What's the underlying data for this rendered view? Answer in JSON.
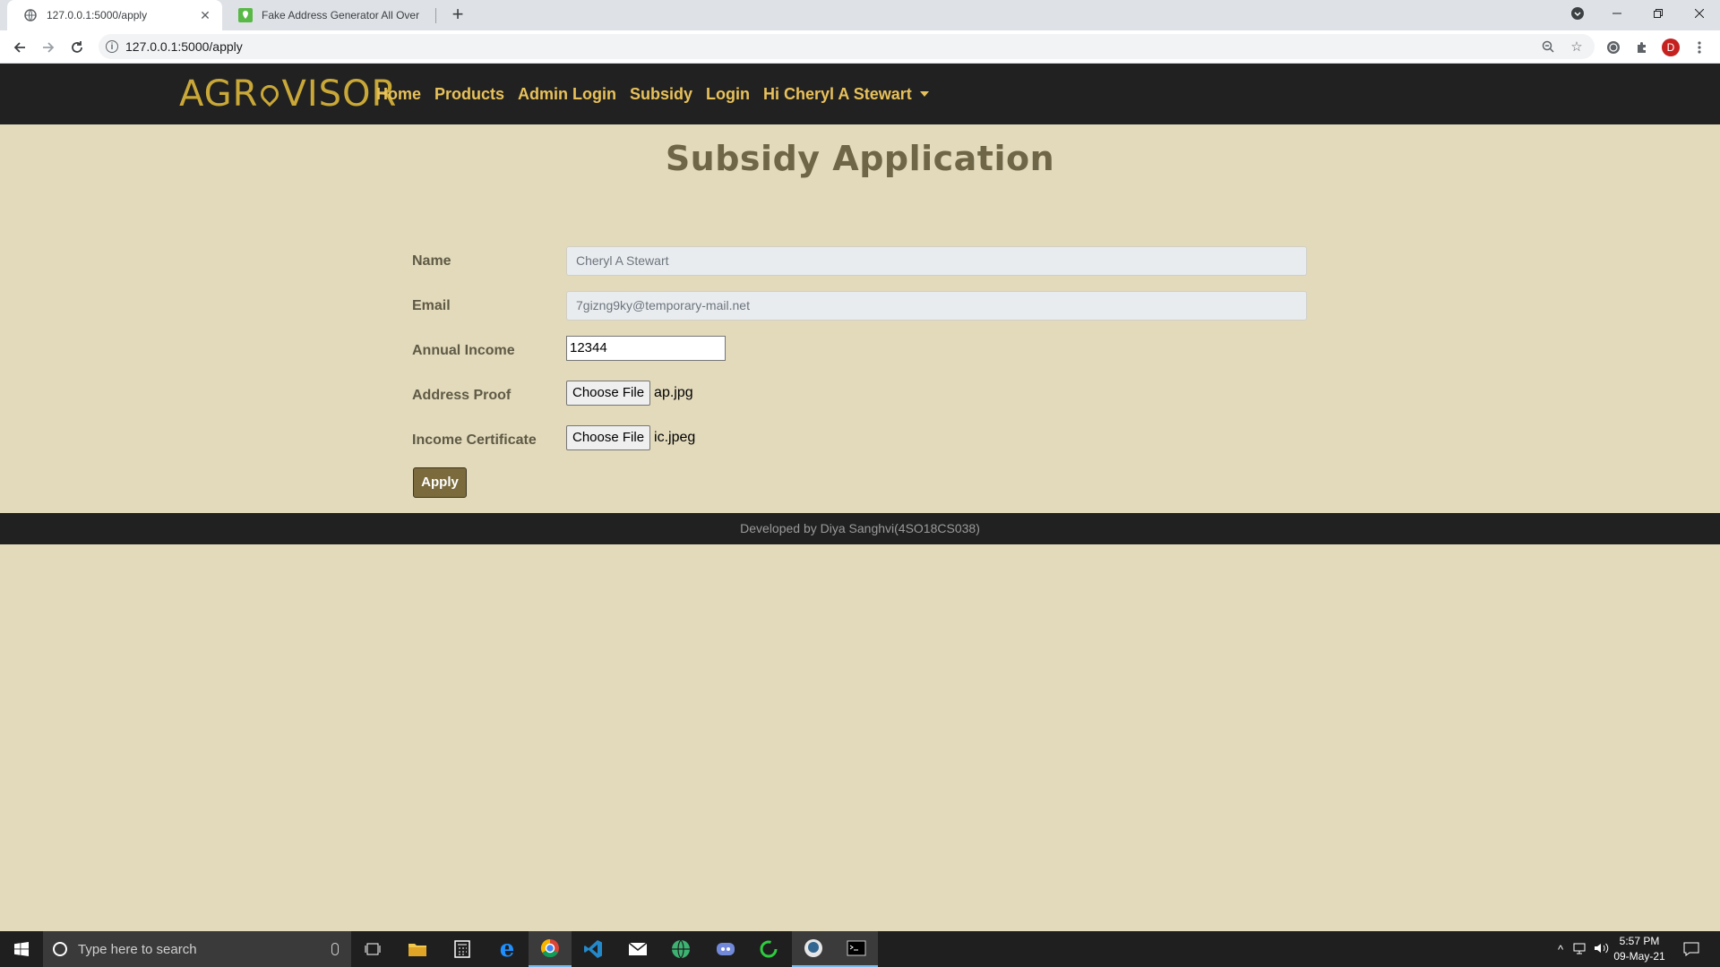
{
  "browser": {
    "tabs": [
      {
        "title": "127.0.0.1:5000/apply",
        "active": true
      },
      {
        "title": "Fake Address Generator All Over",
        "active": false
      }
    ],
    "url": "127.0.0.1:5000/apply",
    "profile_initial": "D"
  },
  "site": {
    "logo_text_left": "AGR",
    "logo_text_right": "VISOR",
    "nav": [
      "Home",
      "Products",
      "Admin Login",
      "Subsidy",
      "Login",
      "Hi Cheryl A Stewart"
    ],
    "accent_color": "#e8c15a"
  },
  "page": {
    "title": "Subsidy Application",
    "fields": {
      "name": {
        "label": "Name",
        "value": "Cheryl A Stewart"
      },
      "email": {
        "label": "Email",
        "value": "7gizng9ky@temporary-mail.net"
      },
      "income": {
        "label": "Annual Income",
        "value": "12344"
      },
      "address_proof": {
        "label": "Address Proof",
        "button": "Choose File",
        "file": "ap.jpg"
      },
      "income_certificate": {
        "label": "Income Certificate",
        "button": "Choose File",
        "file": "ic.jpeg"
      }
    },
    "submit_label": "Apply",
    "footer": "Developed by Diya Sanghvi(4SO18CS038)"
  },
  "taskbar": {
    "search_placeholder": "Type here to search",
    "time": "5:57 PM",
    "date": "09-May-21"
  }
}
